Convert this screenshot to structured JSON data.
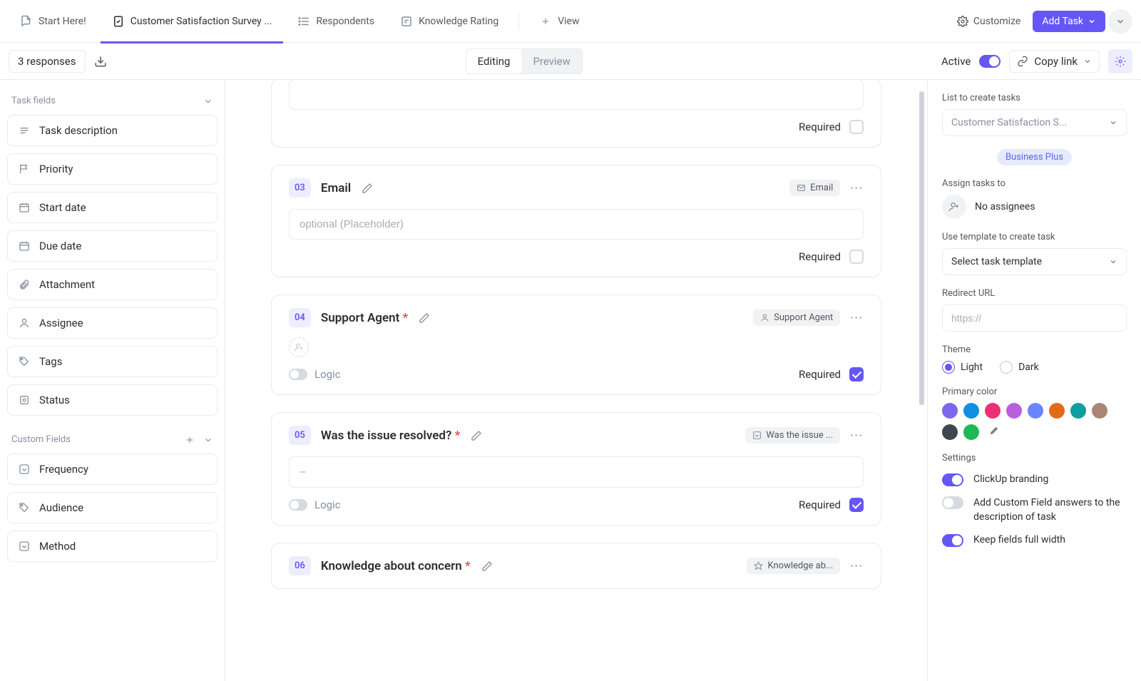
{
  "topnav": {
    "startHere": "Start Here!",
    "survey": "Customer Satisfaction Survey ...",
    "respondents": "Respondents",
    "knowledge": "Knowledge Rating",
    "view": "View",
    "customize": "Customize",
    "addTask": "Add Task"
  },
  "subbar": {
    "responses": "3 responses",
    "editing": "Editing",
    "preview": "Preview",
    "active": "Active",
    "copyLink": "Copy link"
  },
  "leftPanel": {
    "taskFieldsHeader": "Task fields",
    "customFieldsHeader": "Custom Fields",
    "taskFields": [
      "Task description",
      "Priority",
      "Start date",
      "Due date",
      "Attachment",
      "Assignee",
      "Tags",
      "Status"
    ],
    "customFields": [
      "Frequency",
      "Audience",
      "Method"
    ]
  },
  "questions": {
    "q_top": {
      "placeholder": "",
      "requiredLabel": "Required"
    },
    "q3": {
      "num": "03",
      "title": "Email",
      "tag": "Email",
      "placeholder": "optional (Placeholder)",
      "requiredLabel": "Required"
    },
    "q4": {
      "num": "04",
      "title": "Support Agent",
      "tag": "Support Agent",
      "logicLabel": "Logic",
      "requiredLabel": "Required"
    },
    "q5": {
      "num": "05",
      "title": "Was the issue resolved?",
      "tag": "Was the issue ...",
      "dash": "–",
      "logicLabel": "Logic",
      "requiredLabel": "Required"
    },
    "q6": {
      "num": "06",
      "title": "Knowledge about concern",
      "tag": "Knowledge ab..."
    }
  },
  "right": {
    "listLabel": "List to create tasks",
    "listValue": "Customer Satisfaction S...",
    "badge": "Business Plus",
    "assignLabel": "Assign tasks to",
    "noAssignees": "No assignees",
    "templateLabel": "Use template to create task",
    "templateValue": "Select task template",
    "redirectLabel": "Redirect URL",
    "redirectPlaceholder": "https://",
    "themeLabel": "Theme",
    "light": "Light",
    "dark": "Dark",
    "primaryColorLabel": "Primary color",
    "colors": [
      "#7b68ee",
      "#1090e0",
      "#ee2f75",
      "#b660e0",
      "#6985ff",
      "#e16b16",
      "#0f9d9f",
      "#a98673",
      "#3e4651",
      "#1db954"
    ],
    "settingsLabel": "Settings",
    "branding": "ClickUp branding",
    "addCF": "Add Custom Field answers to the description of task",
    "fullWidth": "Keep fields full width"
  }
}
